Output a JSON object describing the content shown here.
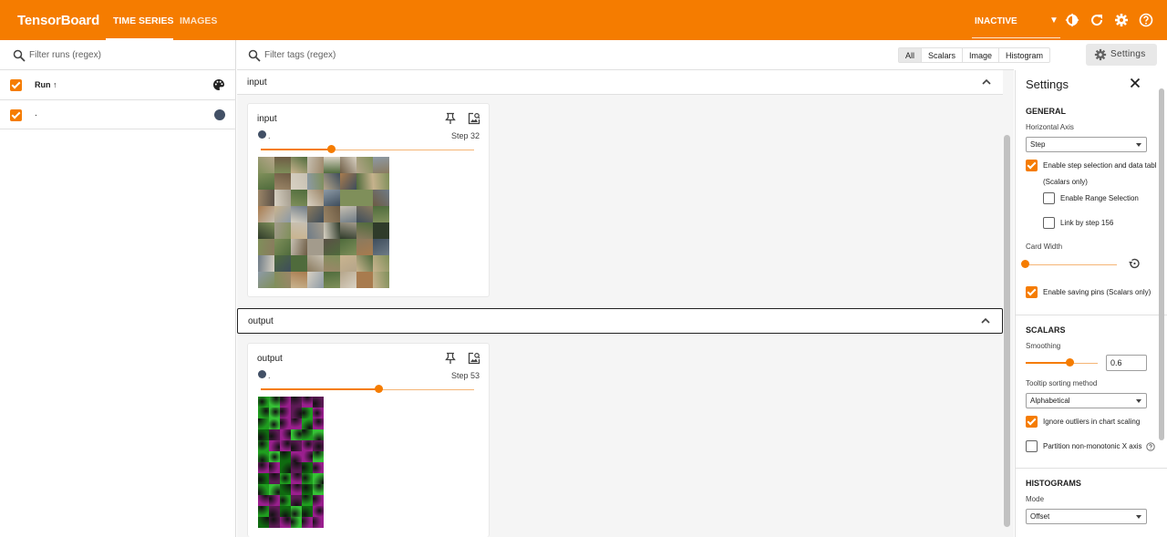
{
  "topbar": {
    "brand": "TensorBoard",
    "tabs": [
      "TIME SERIES",
      "IMAGES"
    ],
    "status": "INACTIVE"
  },
  "runs_panel": {
    "filter_placeholder": "Filter runs (regex)",
    "column_header": "Run ↑",
    "runs": [
      {
        "name": ".",
        "color": "#425066",
        "checked": true
      }
    ]
  },
  "main": {
    "filter_placeholder": "Filter tags (regex)",
    "type_filters": [
      "All",
      "Scalars",
      "Image",
      "Histogram"
    ],
    "active_filter": "All",
    "settings_button": "Settings",
    "groups": [
      {
        "title": "input",
        "card": {
          "tag": "input",
          "run": ".",
          "step_label": "Step 32",
          "slider_fraction": 0.33
        }
      },
      {
        "title": "output",
        "card": {
          "tag": "output",
          "run": ".",
          "step_label": "Step 53",
          "slider_fraction": 0.55
        }
      }
    ]
  },
  "settings": {
    "title": "Settings",
    "general": {
      "heading": "GENERAL",
      "horizontal_axis_label": "Horizontal Axis",
      "horizontal_axis_value": "Step",
      "enable_step_selection": "Enable step selection and data tabl",
      "scalars_only": "(Scalars only)",
      "enable_range_selection": "Enable Range Selection",
      "link_by_step": "Link by step 156",
      "card_width_label": "Card Width",
      "enable_saving_pins": "Enable saving pins (Scalars only)"
    },
    "scalars": {
      "heading": "SCALARS",
      "smoothing_label": "Smoothing",
      "smoothing_value": "0.6",
      "tooltip_sort_label": "Tooltip sorting method",
      "tooltip_sort_value": "Alphabetical",
      "ignore_outliers": "Ignore outliers in chart scaling",
      "partition": "Partition non-monotonic X axis"
    },
    "histograms": {
      "heading": "HISTOGRAMS",
      "mode_label": "Mode",
      "mode_value": "Offset"
    }
  },
  "colors": {
    "accent": "#f57c00",
    "run": "#425066"
  }
}
